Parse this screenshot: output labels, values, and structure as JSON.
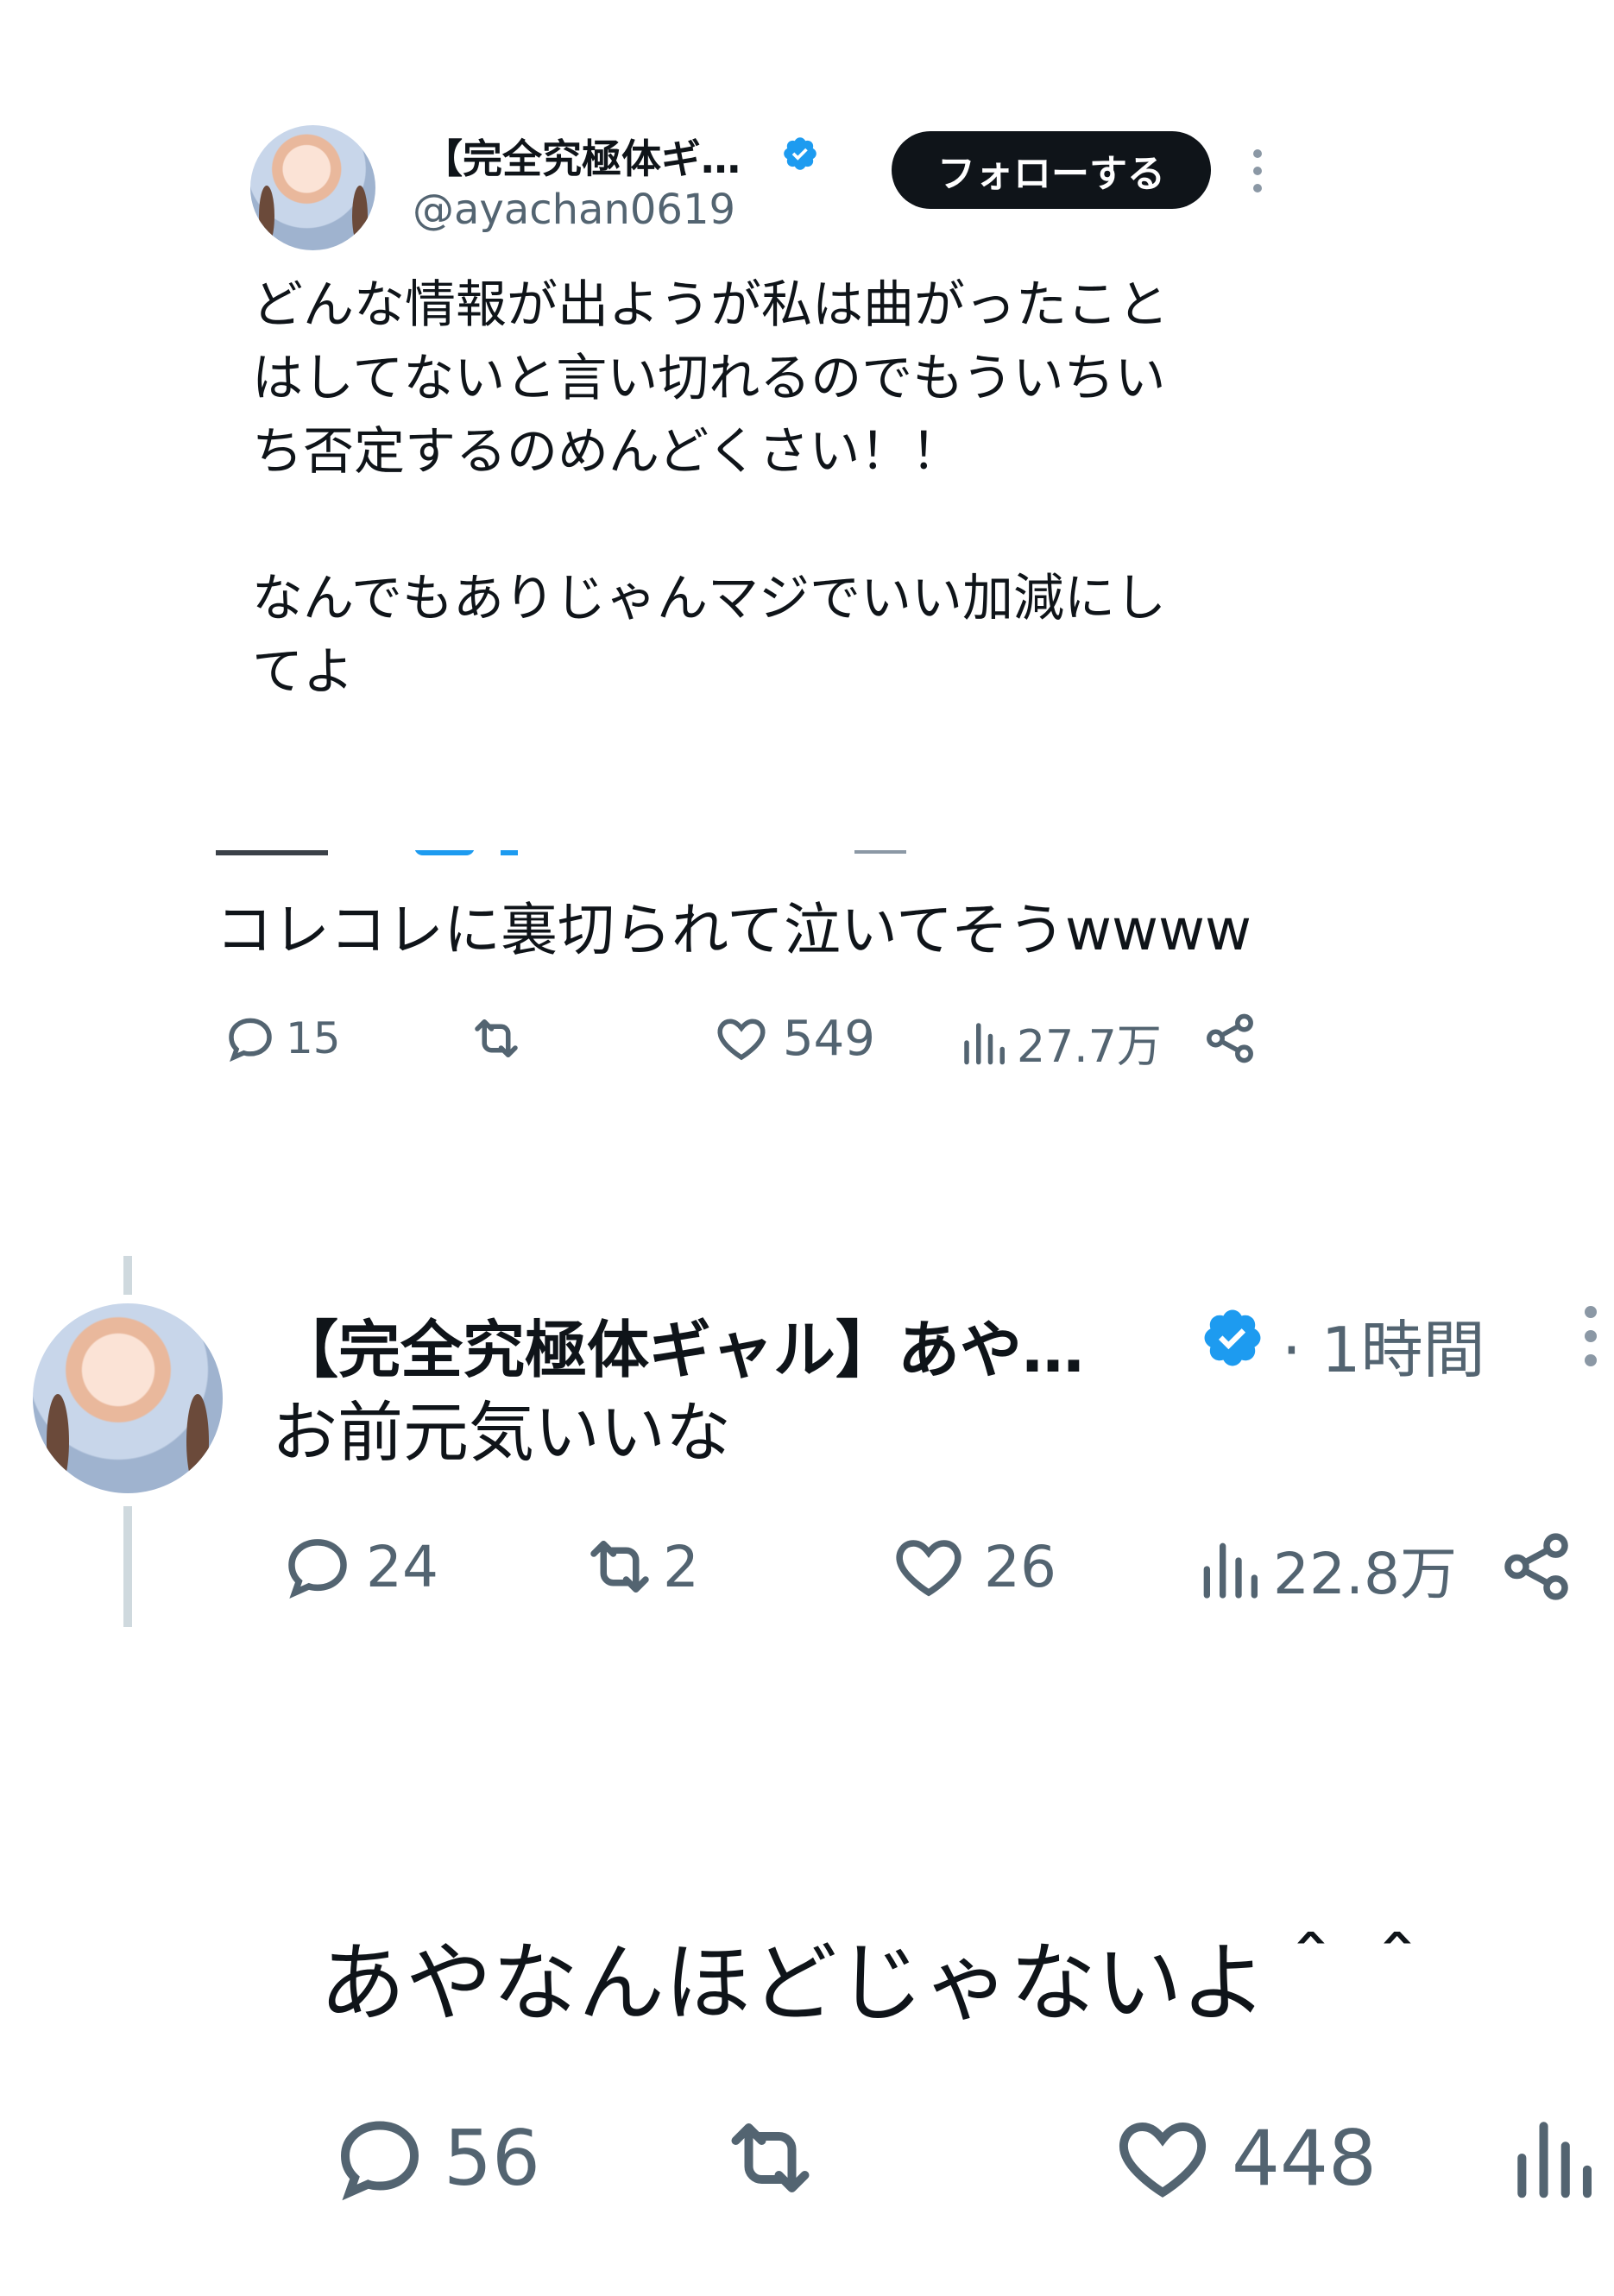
{
  "tweet1": {
    "display_name": "【完全究極体ギ…",
    "handle": "@ayachan0619",
    "follow_label": "フォローする",
    "body": "どんな情報が出ようが私は曲がったこと\nはしてないと言い切れるのでもういちい\nち否定するのめんどくさい！！\n\nなんでもありじゃんマジでいい加減にし\nてよ"
  },
  "tweet2": {
    "body": "コレコレに裏切られて泣いてそうwwww",
    "stats": {
      "replies": "15",
      "retweets": "",
      "likes": "549",
      "views": "27.7万"
    }
  },
  "tweet3": {
    "display_name": "【完全究極体ギャル】あや…",
    "time": "· 1時間",
    "body": "お前元気いいな",
    "stats": {
      "replies": "24",
      "retweets": "2",
      "likes": "26",
      "views": "22.8万"
    }
  },
  "tweet4": {
    "body": "あやなんほどじゃないよ＾＾",
    "stats": {
      "replies": "56",
      "retweets": "",
      "likes": "448"
    }
  },
  "colors": {
    "verified": "#1d9bf0",
    "text": "#0f1419",
    "muted": "#536471",
    "thread_line": "#cfd9de"
  },
  "icons": [
    "verified-badge-icon",
    "more-vertical-icon",
    "reply-icon",
    "retweet-icon",
    "like-icon",
    "views-icon",
    "share-icon"
  ]
}
